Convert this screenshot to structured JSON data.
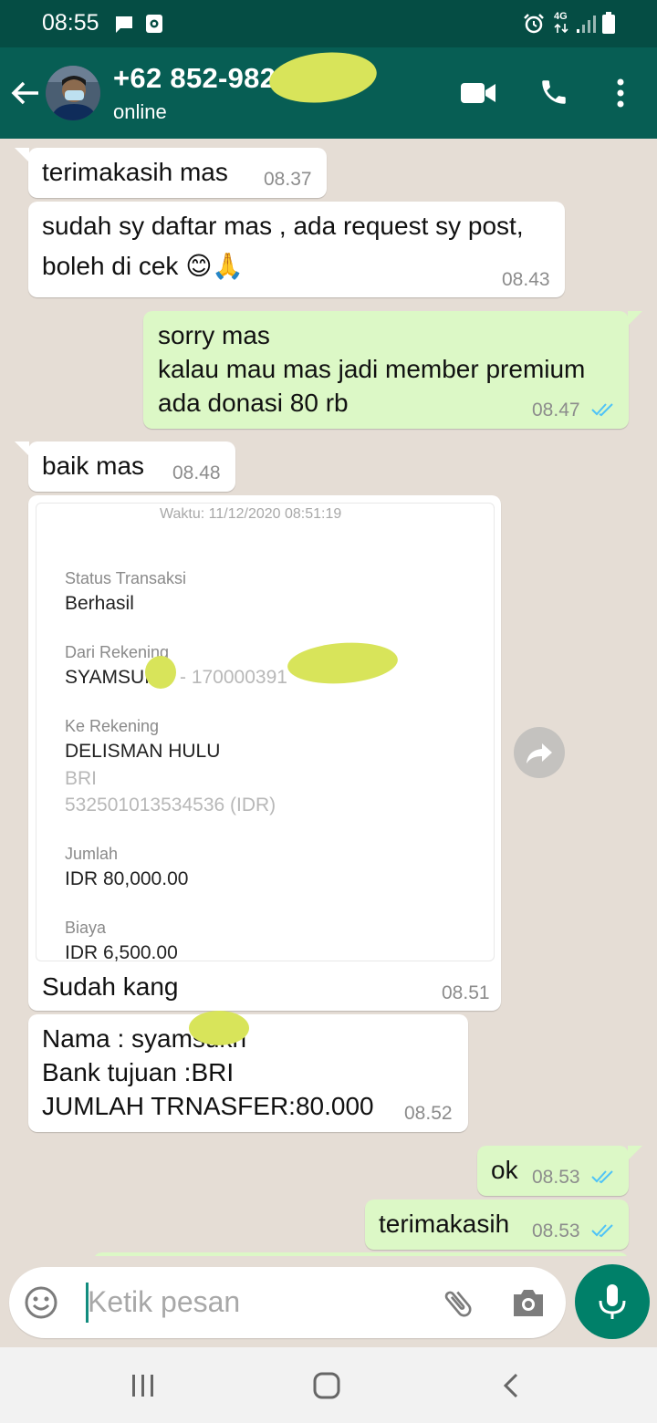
{
  "status_bar": {
    "time": "08:55",
    "network": "4G"
  },
  "header": {
    "contact_name": "+62 852-982",
    "contact_status": "online"
  },
  "messages": [
    {
      "dir": "in",
      "lines": [
        "terimakasih mas"
      ],
      "time": "08.37"
    },
    {
      "dir": "in",
      "lines": [
        "sudah sy daftar mas , ada request sy post,",
        "boleh di cek 😊🙏"
      ],
      "time": "08.43"
    },
    {
      "dir": "out",
      "lines": [
        "sorry mas",
        "kalau mau mas jadi member premium",
        "ada donasi 80 rb"
      ],
      "time": "08.47"
    },
    {
      "dir": "in",
      "lines": [
        "baik mas"
      ],
      "time": "08.48"
    },
    {
      "dir": "in",
      "caption": "Sudah kang",
      "time": "08.51"
    },
    {
      "dir": "in",
      "lines": [
        "Nama : syamsukri",
        "Bank tujuan :BRI",
        "JUMLAH TRNASFER:80.000"
      ],
      "time": "08.52"
    },
    {
      "dir": "out",
      "lines": [
        "ok"
      ],
      "time": "08.53"
    },
    {
      "dir": "out",
      "lines": [
        "terimakasih"
      ],
      "time": "08.53"
    }
  ],
  "receipt": {
    "timestamp": "Waktu: 11/12/2020 08:51:19",
    "status_label": "Status Transaksi",
    "status_value": "Berhasil",
    "from_label": "Dari Rekening",
    "from_name": "SYAMSUI",
    "from_account": "- 170000391",
    "to_label": "Ke Rekening",
    "to_name": "DELISMAN HULU",
    "to_bank": "BRI",
    "to_account": "532501013534536 (IDR)",
    "amount_label": "Jumlah",
    "amount_value": "IDR 80,000.00",
    "fee_label": "Biaya",
    "fee_value": "IDR 6,500.00"
  },
  "input": {
    "placeholder": "Ketik pesan"
  },
  "colors": {
    "header": "#075e54",
    "status_bar": "#054d44",
    "outgoing": "#dcf8c6",
    "incoming": "#ffffff",
    "chat_bg": "#e5ddd5",
    "tick_read": "#4fc3f7",
    "mic": "#008069",
    "redaction": "#d8e45a"
  }
}
